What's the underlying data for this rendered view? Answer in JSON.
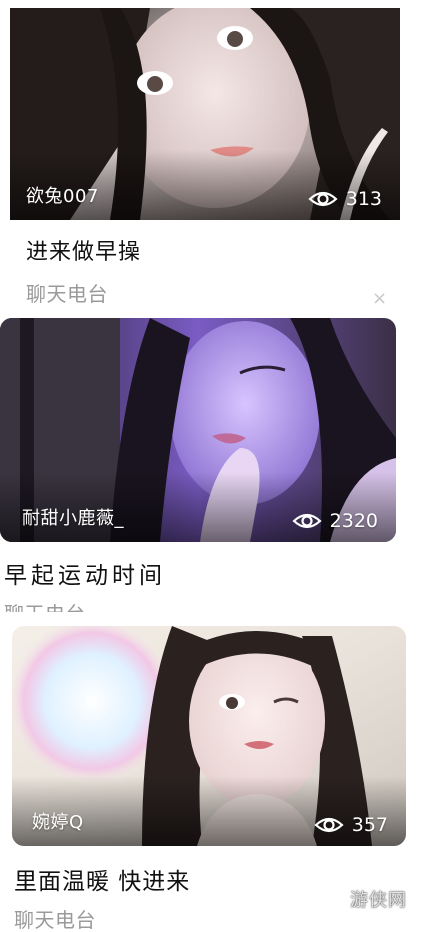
{
  "cards": [
    {
      "host": "欲兔007",
      "views": "313",
      "title": "进来做早操",
      "category": "聊天电台"
    },
    {
      "host": "耐甜小鹿薇_",
      "views": "2320",
      "title": "早起运动时间",
      "category": "聊天电台"
    },
    {
      "host": "婉婷Q",
      "views": "357",
      "title": "里面温暖 快进来",
      "category": "聊天电台"
    }
  ],
  "close_glyph": "×",
  "watermark": "游侠网",
  "icons": {
    "views": "eye-icon",
    "close": "close-icon"
  }
}
